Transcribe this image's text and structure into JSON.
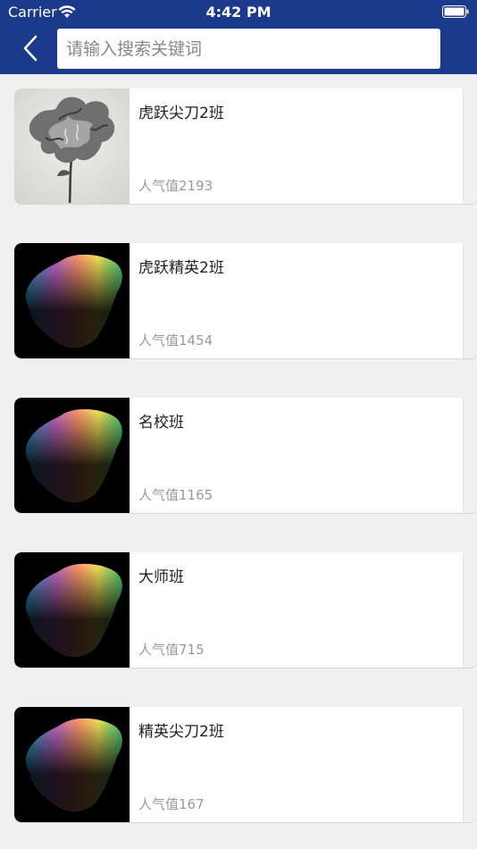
{
  "status_bar": {
    "carrier": "Carrier",
    "time": "4:42 PM"
  },
  "search": {
    "placeholder": "请输入搜索关键词",
    "value": ""
  },
  "classes": [
    {
      "name": "虎跃尖刀2班",
      "popularity": "人气值2193",
      "thumb": "flower-photo"
    },
    {
      "name": "虎跃精英2班",
      "popularity": "人气值1454",
      "thumb": "colorful-rock"
    },
    {
      "name": "名校班",
      "popularity": "人气值1165",
      "thumb": "colorful-rock"
    },
    {
      "name": "大师班",
      "popularity": "人气值715",
      "thumb": "colorful-rock"
    },
    {
      "name": "精英尖刀2班",
      "popularity": "人气值167",
      "thumb": "colorful-rock"
    }
  ],
  "colors": {
    "header": "#1b3a8c",
    "background": "#f0f0f0"
  }
}
